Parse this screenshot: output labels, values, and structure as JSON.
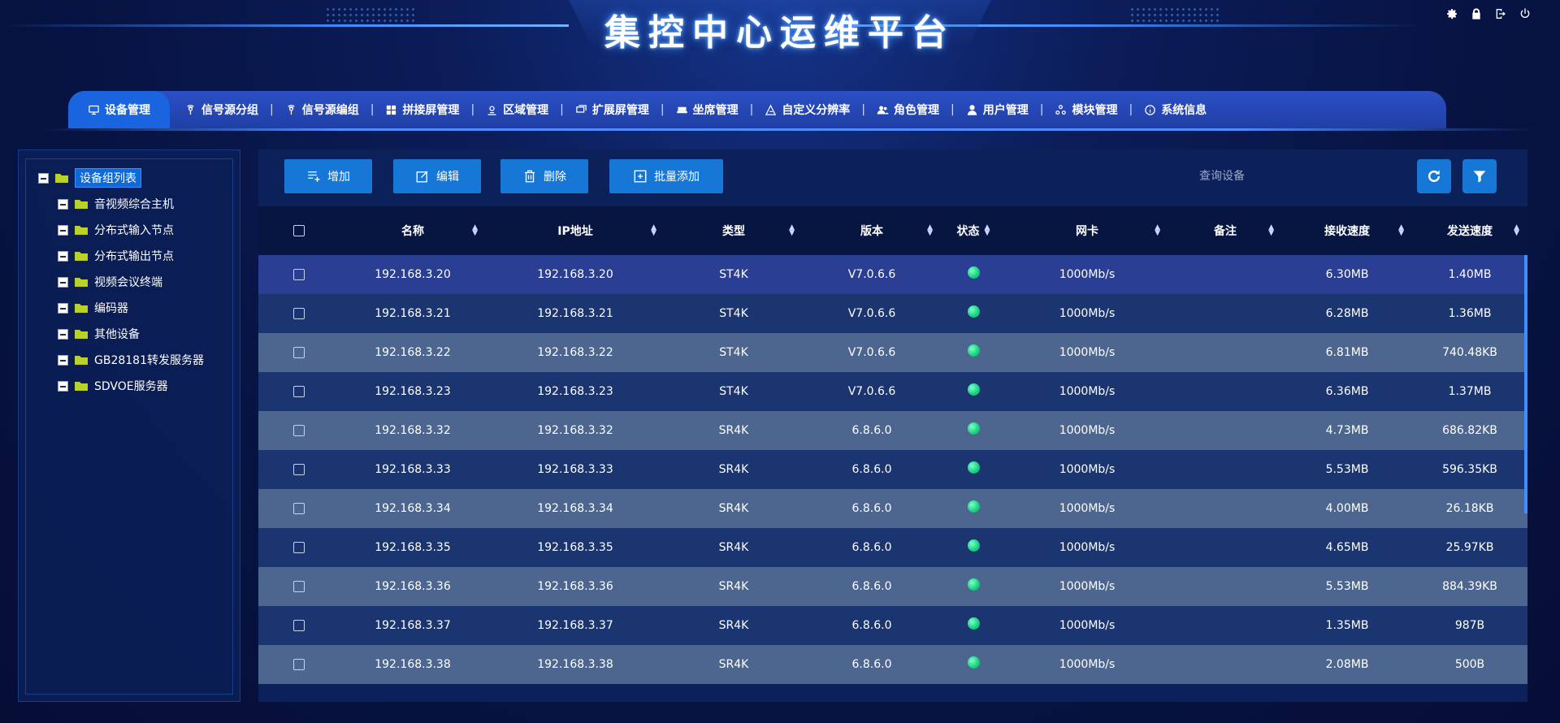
{
  "app": {
    "title": "集控中心运维平台"
  },
  "header_icons": [
    "gear-icon",
    "lock-icon",
    "logout-icon",
    "power-icon"
  ],
  "tabs": [
    {
      "label": "设备管理",
      "icon": "monitor-icon",
      "active": true
    },
    {
      "label": "信号源分组",
      "icon": "signal-icon"
    },
    {
      "label": "信号源编组",
      "icon": "signal-icon"
    },
    {
      "label": "拼接屏管理",
      "icon": "grid-icon"
    },
    {
      "label": "区域管理",
      "icon": "location-icon"
    },
    {
      "label": "扩展屏管理",
      "icon": "screen-icon"
    },
    {
      "label": "坐席管理",
      "icon": "seat-icon"
    },
    {
      "label": "自定义分辨率",
      "icon": "resolution-icon"
    },
    {
      "label": "角色管理",
      "icon": "role-icon"
    },
    {
      "label": "用户管理",
      "icon": "user-icon"
    },
    {
      "label": "模块管理",
      "icon": "module-icon"
    },
    {
      "label": "系统信息",
      "icon": "info-icon"
    }
  ],
  "sidebar": {
    "root": "设备组列表",
    "items": [
      "音视频综合主机",
      "分布式输入节点",
      "分布式输出节点",
      "视频会议终端",
      "编码器",
      "其他设备",
      "GB28181转发服务器",
      "SDVOE服务器"
    ]
  },
  "toolbar": {
    "add_label": "增加",
    "edit_label": "编辑",
    "delete_label": "删除",
    "batch_add_label": "批量添加",
    "search_placeholder": "查询设备"
  },
  "table": {
    "columns": [
      "名称",
      "IP地址",
      "类型",
      "版本",
      "状态",
      "网卡",
      "备注",
      "接收速度",
      "发送速度"
    ],
    "rows": [
      {
        "name": "192.168.3.20",
        "ip": "192.168.3.20",
        "type": "ST4K",
        "version": "V7.0.6.6",
        "nic": "1000Mb/s",
        "note": "",
        "rx": "6.30MB",
        "tx": "1.40MB"
      },
      {
        "name": "192.168.3.21",
        "ip": "192.168.3.21",
        "type": "ST4K",
        "version": "V7.0.6.6",
        "nic": "1000Mb/s",
        "note": "",
        "rx": "6.28MB",
        "tx": "1.36MB"
      },
      {
        "name": "192.168.3.22",
        "ip": "192.168.3.22",
        "type": "ST4K",
        "version": "V7.0.6.6",
        "nic": "1000Mb/s",
        "note": "",
        "rx": "6.81MB",
        "tx": "740.48KB"
      },
      {
        "name": "192.168.3.23",
        "ip": "192.168.3.23",
        "type": "ST4K",
        "version": "V7.0.6.6",
        "nic": "1000Mb/s",
        "note": "",
        "rx": "6.36MB",
        "tx": "1.37MB"
      },
      {
        "name": "192.168.3.32",
        "ip": "192.168.3.32",
        "type": "SR4K",
        "version": "6.8.6.0",
        "nic": "1000Mb/s",
        "note": "",
        "rx": "4.73MB",
        "tx": "686.82KB"
      },
      {
        "name": "192.168.3.33",
        "ip": "192.168.3.33",
        "type": "SR4K",
        "version": "6.8.6.0",
        "nic": "1000Mb/s",
        "note": "",
        "rx": "5.53MB",
        "tx": "596.35KB"
      },
      {
        "name": "192.168.3.34",
        "ip": "192.168.3.34",
        "type": "SR4K",
        "version": "6.8.6.0",
        "nic": "1000Mb/s",
        "note": "",
        "rx": "4.00MB",
        "tx": "26.18KB"
      },
      {
        "name": "192.168.3.35",
        "ip": "192.168.3.35",
        "type": "SR4K",
        "version": "6.8.6.0",
        "nic": "1000Mb/s",
        "note": "",
        "rx": "4.65MB",
        "tx": "25.97KB"
      },
      {
        "name": "192.168.3.36",
        "ip": "192.168.3.36",
        "type": "SR4K",
        "version": "6.8.6.0",
        "nic": "1000Mb/s",
        "note": "",
        "rx": "5.53MB",
        "tx": "884.39KB"
      },
      {
        "name": "192.168.3.37",
        "ip": "192.168.3.37",
        "type": "SR4K",
        "version": "6.8.6.0",
        "nic": "1000Mb/s",
        "note": "",
        "rx": "1.35MB",
        "tx": "987B"
      },
      {
        "name": "192.168.3.38",
        "ip": "192.168.3.38",
        "type": "SR4K",
        "version": "6.8.6.0",
        "nic": "1000Mb/s",
        "note": "",
        "rx": "2.08MB",
        "tx": "500B"
      }
    ]
  },
  "colors": {
    "accent": "#1677d6",
    "status_online": "#12d080",
    "row_selected": "#2a3e93"
  }
}
